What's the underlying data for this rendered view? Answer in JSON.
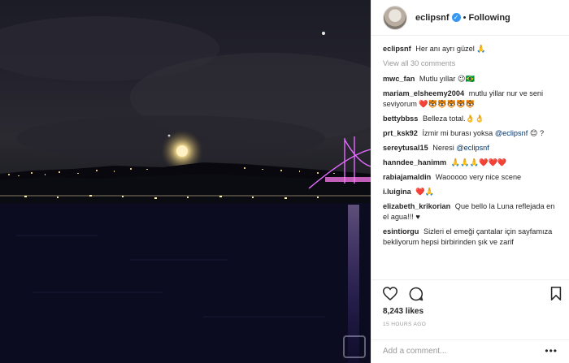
{
  "post": {
    "username": "eclipsnf",
    "verified_mark": "✓",
    "separator": "•",
    "follow_status": "Following",
    "caption": "Her anı ayrı güzel",
    "caption_emoji": "🙏",
    "view_all": "View all 30 comments",
    "likes": "8,243 likes",
    "time": "15 HOURS AGO",
    "add_comment_placeholder": "Add a comment...",
    "more_options": "•••"
  },
  "comments": [
    {
      "user": "mwc_fan",
      "text": "Mutlu yıllar 😉🇧🇷"
    },
    {
      "user": "mariam_elsheemy2004",
      "text": "mutlu yillar nur ve seni seviyorum ❤️🐯🐯🐯🐯🐯"
    },
    {
      "user": "bettybbss",
      "text": "Belleza total.👌👌"
    },
    {
      "user": "prt_ksk92",
      "text": "İzmir mi burası yoksa ",
      "mention": "@eclipsnf",
      "text2": " 😊 ?"
    },
    {
      "user": "sereytusal15",
      "text": "Neresi ",
      "mention": "@eclipsnf"
    },
    {
      "user": "hanndee_hanimm",
      "text": "🙏🙏🙏❤️❤️❤️"
    },
    {
      "user": "rabiajamaldin",
      "text": "Waooooo very nice scene"
    },
    {
      "user": "i.luigina",
      "text": "❤️🙏"
    },
    {
      "user": "elizabeth_krikorian",
      "text": "Que bello la Luna reflejada en el agua!!! ♥"
    },
    {
      "user": "esintiorgu",
      "text": "Sizleri el emeği çantalar için sayfamıza bekliyorum hepsi birbirinden şık ve zarif"
    }
  ],
  "icons": {
    "like": "heart-icon",
    "comment": "comment-icon",
    "save": "bookmark-icon"
  },
  "colors": {
    "verified": "#3897f0",
    "mention": "#003569",
    "meta_gray": "#999999"
  }
}
